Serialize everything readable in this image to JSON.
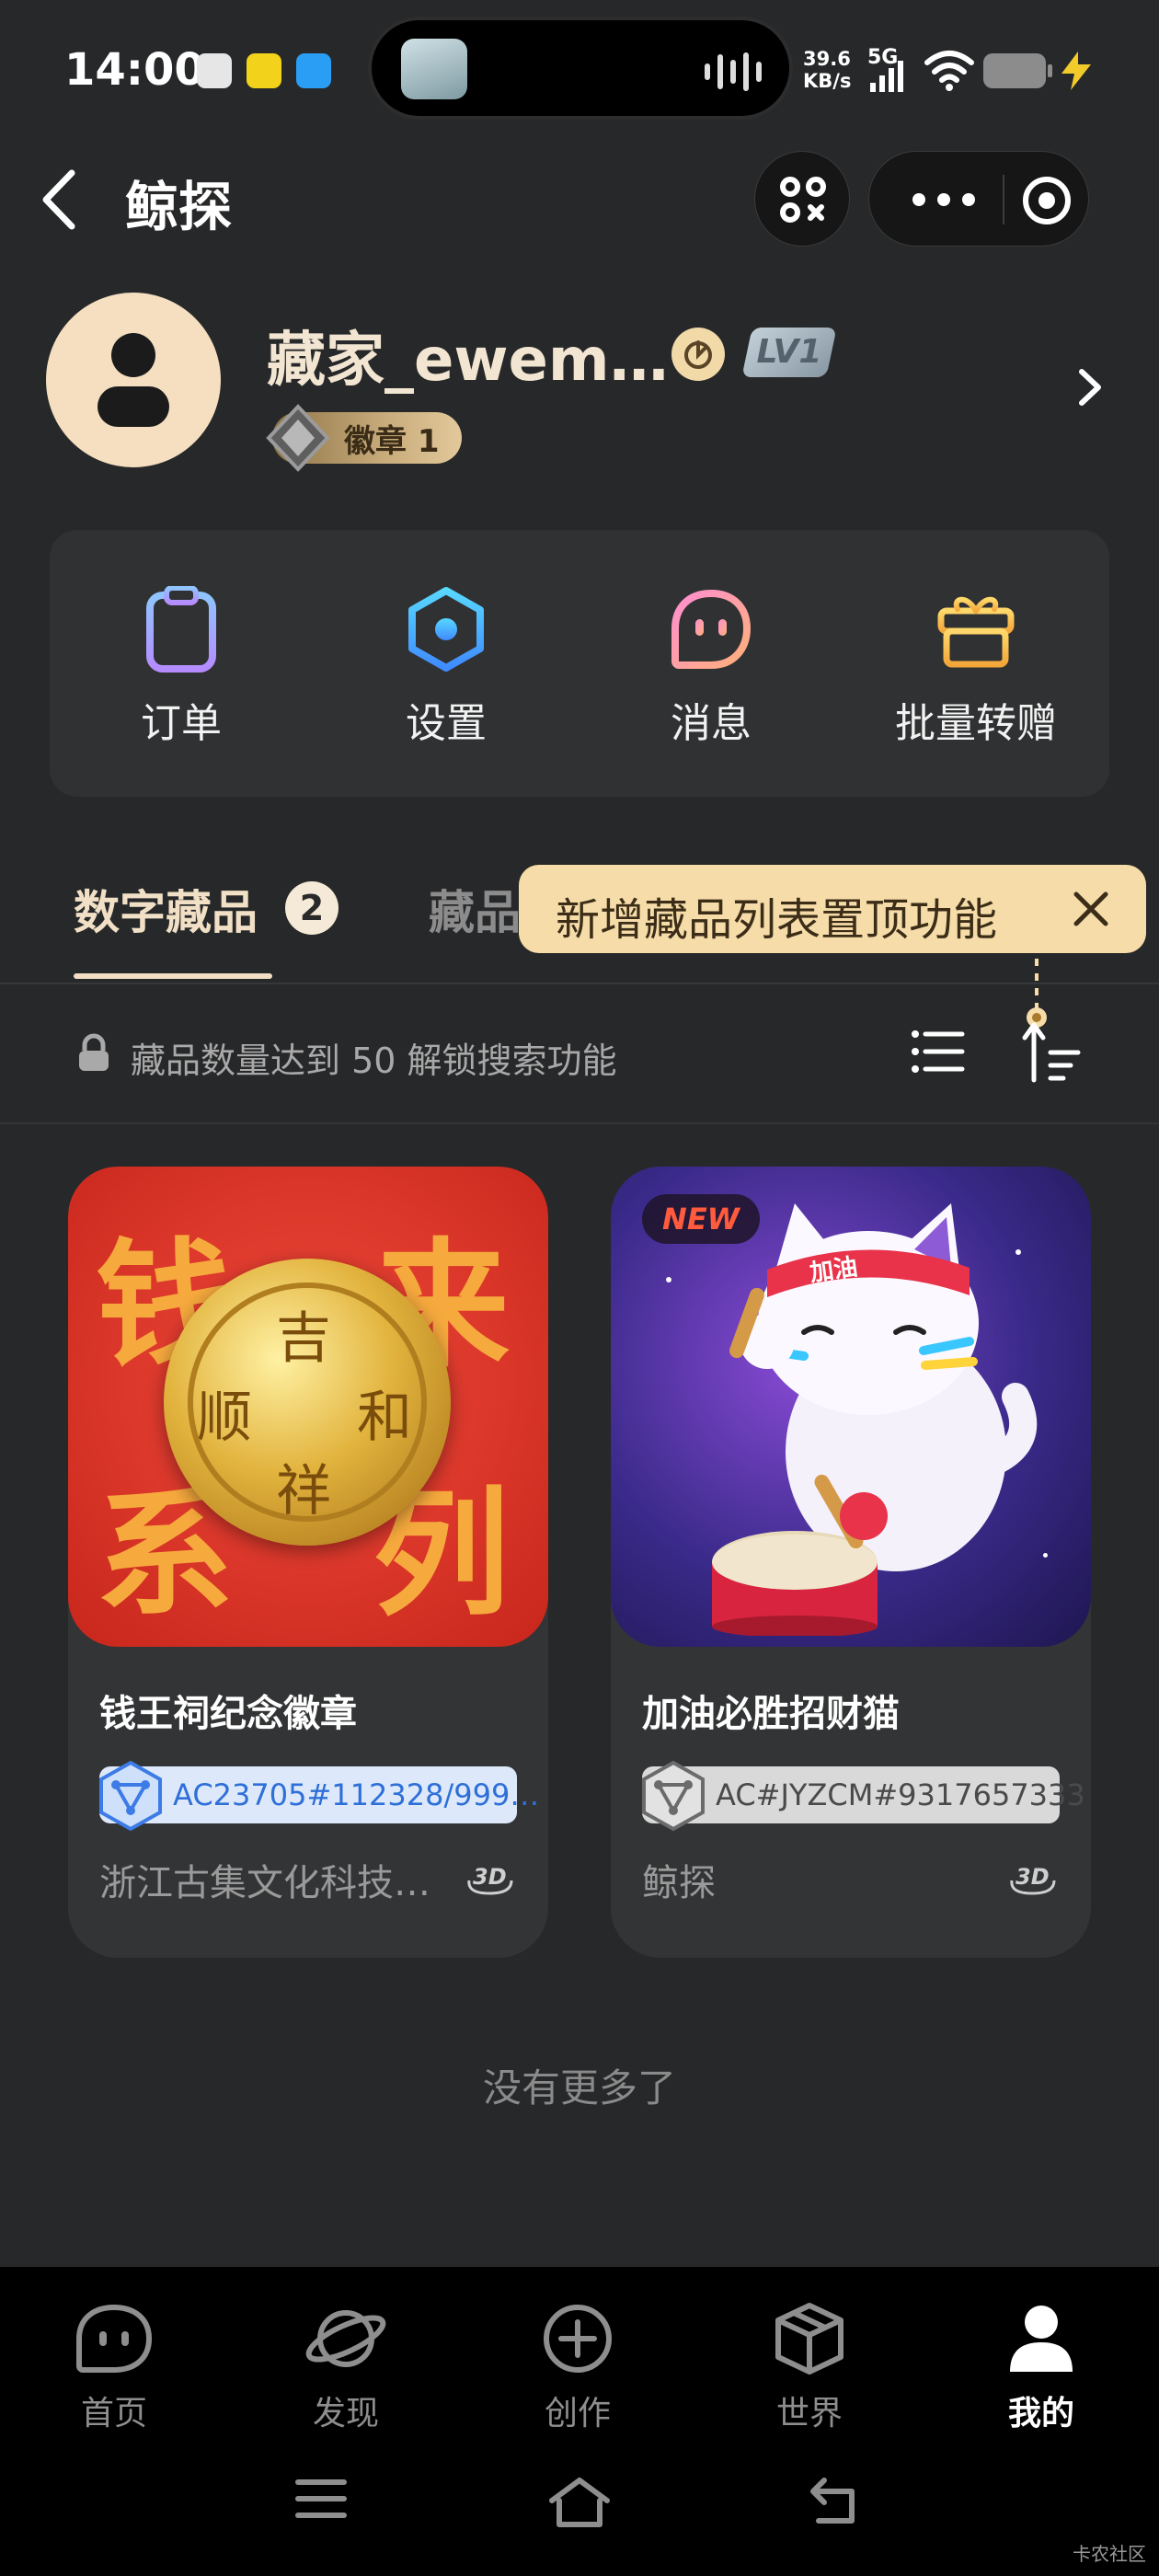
{
  "status_bar": {
    "time": "14:00",
    "net_speed_value": "39.6",
    "net_speed_unit": "KB/s",
    "network": "5G"
  },
  "header": {
    "title": "鲸探"
  },
  "profile": {
    "username": "藏家_ewem…",
    "level": "LV1",
    "badge_label": "徽章 1"
  },
  "actions": [
    {
      "label": "订单",
      "icon": "clipboard-icon"
    },
    {
      "label": "设置",
      "icon": "hexagon-settings-icon"
    },
    {
      "label": "消息",
      "icon": "message-face-icon"
    },
    {
      "label": "批量转赠",
      "icon": "gift-icon"
    }
  ],
  "tabs": {
    "active_label": "数字藏品",
    "active_count": "2",
    "inactive_label": "藏品"
  },
  "tooltip": {
    "text": "新增藏品列表置顶功能"
  },
  "filter": {
    "hint": "藏品数量达到 50 解锁搜索功能"
  },
  "collectibles": [
    {
      "title": "钱王祠纪念徽章",
      "hash": "AC23705#112328/999…",
      "issuer": "浙江古集文化科技…",
      "image_text": {
        "top_left": "钱",
        "top_right": "来",
        "bottom_left": "系",
        "bottom_right": "列",
        "coin_top": "吉",
        "coin_left": "顺",
        "coin_right": "和",
        "coin_bottom": "祥"
      }
    },
    {
      "title": "加油必胜招财猫",
      "hash": "AC#JYZCM#9317657333",
      "issuer": "鲸探",
      "tag": "NEW",
      "image_text": {
        "headband": "加油"
      }
    }
  ],
  "footer_text": "没有更多了",
  "bottom_nav": [
    {
      "label": "首页",
      "icon": "home-face-icon",
      "active": false
    },
    {
      "label": "发现",
      "icon": "planet-icon",
      "active": false
    },
    {
      "label": "创作",
      "icon": "plus-circle-icon",
      "active": false
    },
    {
      "label": "世界",
      "icon": "cube-icon",
      "active": false
    },
    {
      "label": "我的",
      "icon": "person-icon",
      "active": true
    }
  ],
  "watermark": "卡农社区",
  "colors": {
    "background": "#272829",
    "accent_gold": "#f1e0c6",
    "tooltip": "#f6dca8"
  }
}
